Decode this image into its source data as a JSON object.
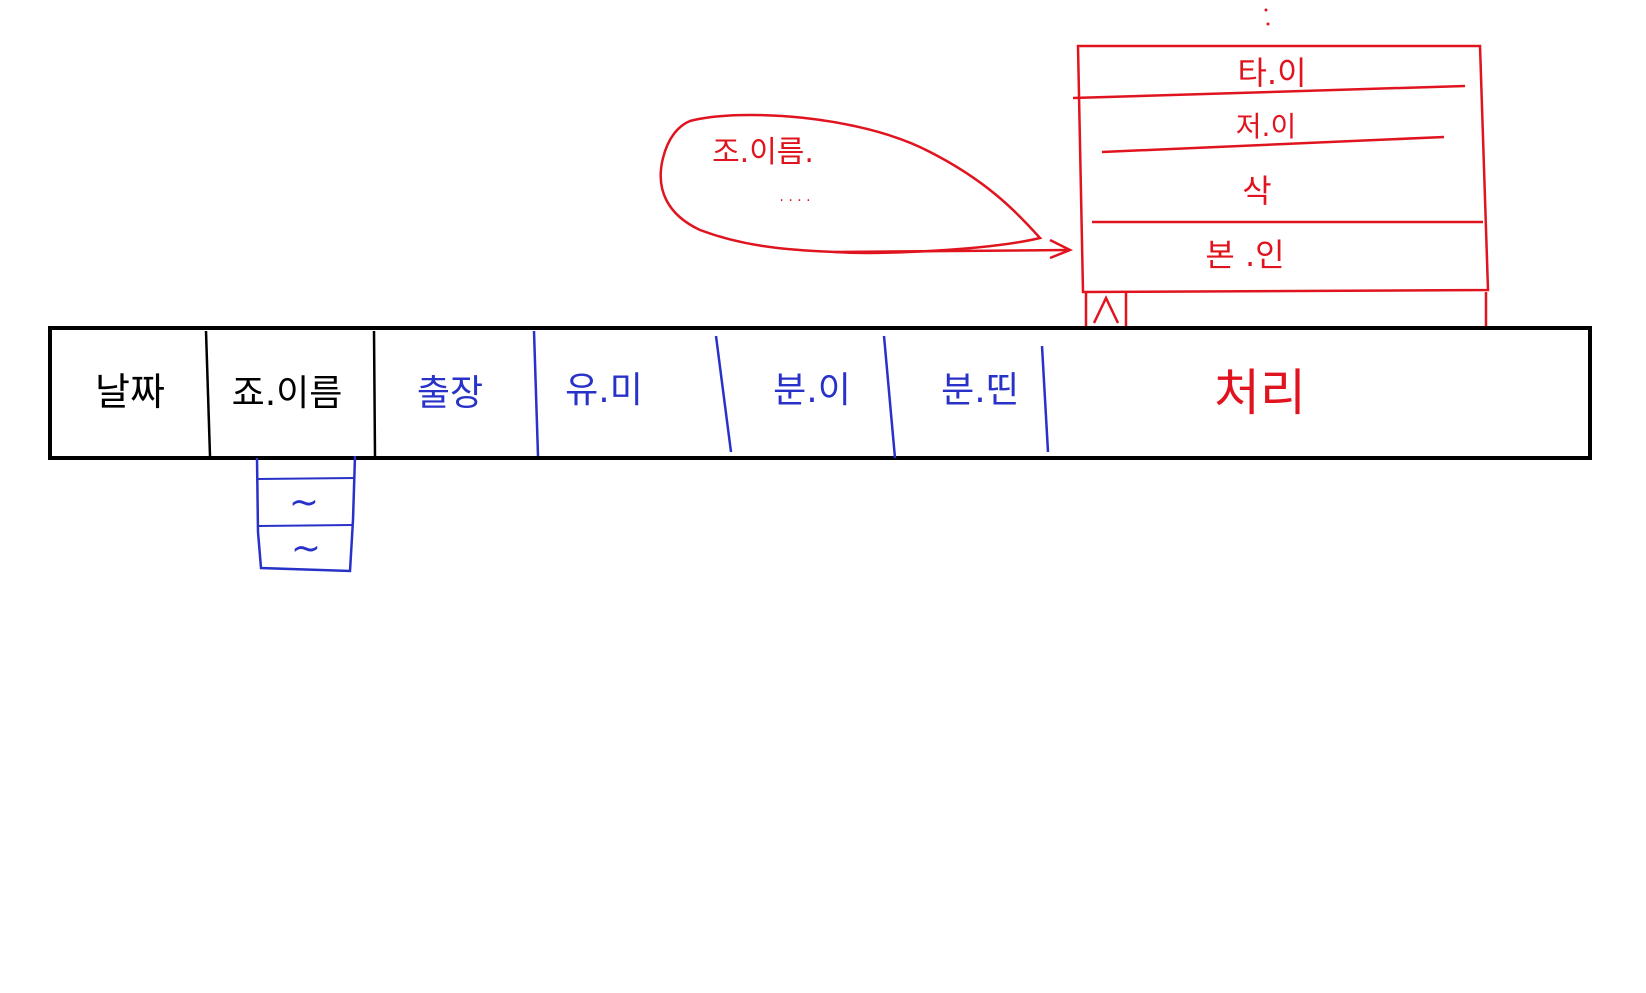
{
  "colors": {
    "black": "#000000",
    "blue": "#2832c8",
    "red": "#e0141e"
  },
  "table": {
    "columns": [
      {
        "label": "날짜",
        "color": "black"
      },
      {
        "label": "죠.이름",
        "color": "black"
      },
      {
        "label": "출장",
        "color": "blue"
      },
      {
        "label": "유.미",
        "color": "blue"
      },
      {
        "label": "분.이",
        "color": "blue"
      },
      {
        "label": "분.띤",
        "color": "blue"
      },
      {
        "label": "처리",
        "color": "red"
      }
    ]
  },
  "dropdown": {
    "items": [
      "~",
      "~"
    ]
  },
  "callout": {
    "title": "조.이름.",
    "dots": "· · · ·"
  },
  "menu": {
    "items": [
      "타.이",
      "저.이",
      "삭",
      "본 .인"
    ]
  }
}
